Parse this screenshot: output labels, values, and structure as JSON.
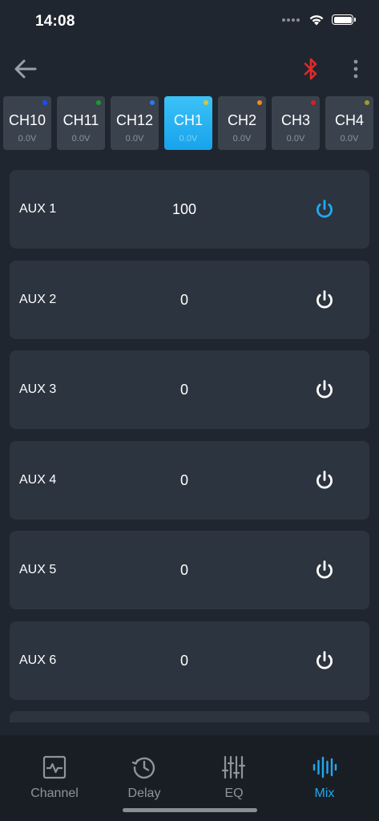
{
  "status_bar": {
    "time": "14:08"
  },
  "header": {
    "back_icon": "arrow-left-icon",
    "bluetooth_icon": "bluetooth-icon",
    "bluetooth_color": "#e02a2a",
    "more_icon": "more-vertical-icon"
  },
  "channels": [
    {
      "name": "CH10",
      "voltage": "0.0V",
      "dot_color": "#1a4cff",
      "active": false
    },
    {
      "name": "CH11",
      "voltage": "0.0V",
      "dot_color": "#1c9a2c",
      "active": false
    },
    {
      "name": "CH12",
      "voltage": "0.0V",
      "dot_color": "#2b7bf0",
      "active": false
    },
    {
      "name": "CH1",
      "voltage": "0.0V",
      "dot_color": "#d8c43a",
      "active": true
    },
    {
      "name": "CH2",
      "voltage": "0.0V",
      "dot_color": "#f08a1c",
      "active": false
    },
    {
      "name": "CH3",
      "voltage": "0.0V",
      "dot_color": "#d82020",
      "active": false
    },
    {
      "name": "CH4",
      "voltage": "0.0V",
      "dot_color": "#9aa02a",
      "active": false
    }
  ],
  "aux": [
    {
      "label": "AUX 1",
      "value": "100",
      "power_on": true
    },
    {
      "label": "AUX 2",
      "value": "0",
      "power_on": false
    },
    {
      "label": "AUX 3",
      "value": "0",
      "power_on": false
    },
    {
      "label": "AUX 4",
      "value": "0",
      "power_on": false
    },
    {
      "label": "AUX 5",
      "value": "0",
      "power_on": false
    },
    {
      "label": "AUX 6",
      "value": "0",
      "power_on": false
    }
  ],
  "colors": {
    "accent": "#22a9ee",
    "power_off": "#ffffff",
    "tab_inactive": "#8d949d"
  },
  "tabs": [
    {
      "label": "Channel",
      "icon": "channel-pulse-icon",
      "active": false
    },
    {
      "label": "Delay",
      "icon": "history-clock-icon",
      "active": false
    },
    {
      "label": "EQ",
      "icon": "equalizer-sliders-icon",
      "active": false
    },
    {
      "label": "Mix",
      "icon": "mix-bars-icon",
      "active": true
    }
  ]
}
